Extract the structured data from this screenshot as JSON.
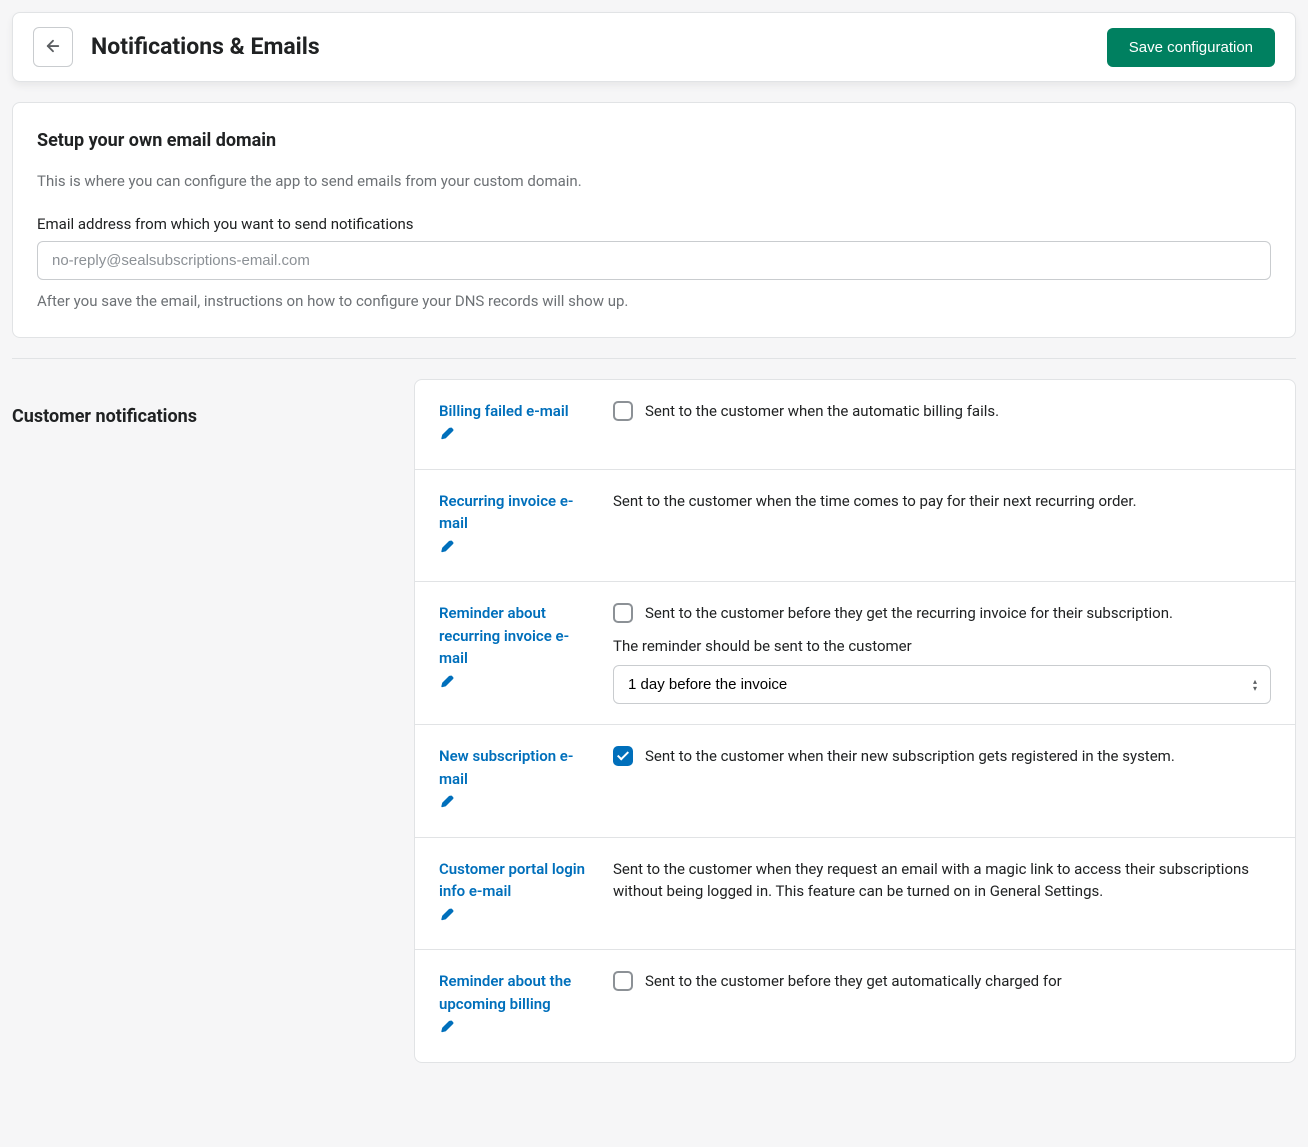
{
  "header": {
    "title": "Notifications & Emails",
    "save_label": "Save configuration"
  },
  "email_domain": {
    "title": "Setup your own email domain",
    "intro": "This is where you can configure the app to send emails from your custom domain.",
    "field_label": "Email address from which you want to send notifications",
    "placeholder": "no-reply@sealsubscriptions-email.com",
    "value": "",
    "helper": "After you save the email, instructions on how to configure your DNS records will show up."
  },
  "customer_notifications": {
    "section_title": "Customer notifications",
    "reminder_label": "The reminder should be sent to the customer",
    "reminder_select": "1 day before the invoice",
    "items": [
      {
        "title": "Billing failed e-mail",
        "has_checkbox": true,
        "checked": false,
        "desc": "Sent to the customer when the automatic billing fails."
      },
      {
        "title": "Recurring invoice e-mail",
        "has_checkbox": false,
        "checked": false,
        "desc": "Sent to the customer when the time comes to pay for their next recurring order."
      },
      {
        "title": "Reminder about recurring invoice e-mail",
        "has_checkbox": true,
        "checked": false,
        "desc": "Sent to the customer before they get the recurring invoice for their subscription.",
        "has_reminder_select": true
      },
      {
        "title": "New subscription e-mail",
        "has_checkbox": true,
        "checked": true,
        "desc": "Sent to the customer when their new subscription gets registered in the system."
      },
      {
        "title": "Customer portal login info e-mail",
        "has_checkbox": false,
        "checked": false,
        "desc": "Sent to the customer when they request an email with a magic link to access their subscriptions without being logged in. This feature can be turned on in General Settings."
      },
      {
        "title": "Reminder about the upcoming billing",
        "has_checkbox": true,
        "checked": false,
        "desc": "Sent to the customer before they get automatically charged for"
      }
    ]
  }
}
